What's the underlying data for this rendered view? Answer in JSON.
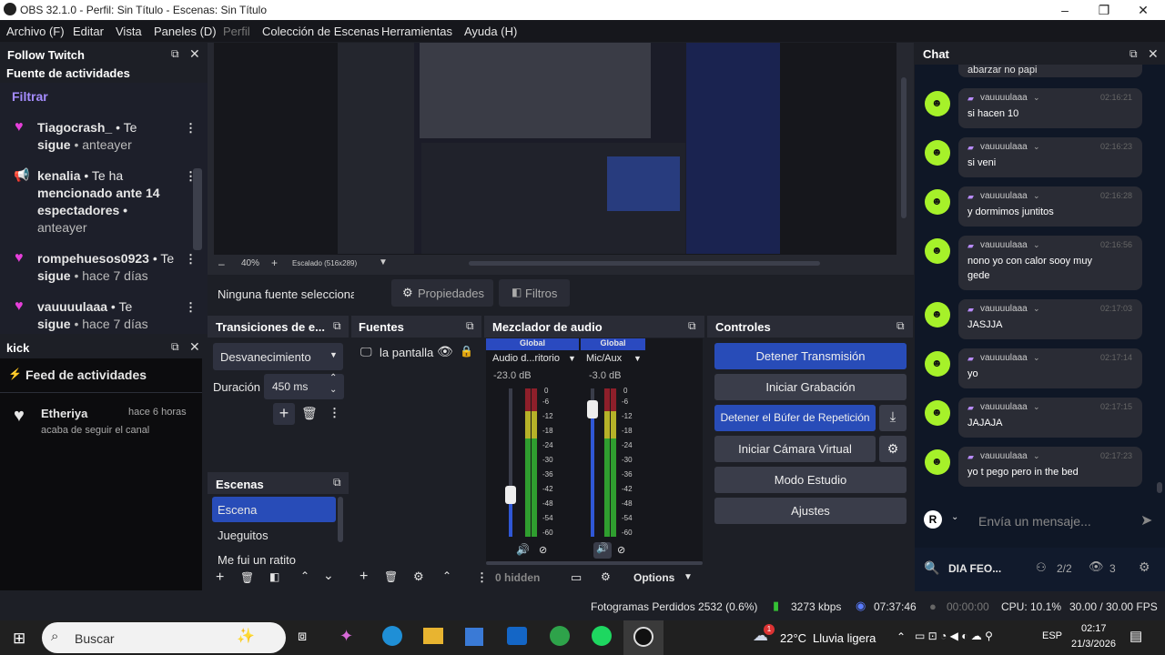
{
  "titlebar": {
    "title": "OBS 32.1.0 - Perfil: Sin Título - Escenas: Sin Título"
  },
  "menu": [
    "Archivo (F)",
    "Editar",
    "Vista",
    "Paneles (D)",
    "Perfil",
    "Colección de Escenas",
    "Herramientas",
    "Ayuda (H)"
  ],
  "follow": {
    "title": "Follow Twitch",
    "subtitle": "Fuente de actividades",
    "filter": "Filtrar",
    "items": [
      {
        "name": "Tiagocrash_",
        "line1": " • Te",
        "line2a": "sigue",
        "line2b": " • anteayer"
      },
      {
        "name": "kenalia",
        "line1": " • Te ha",
        "line2": "mencionado ante 14",
        "line3": "espectadores •",
        "line4": "anteayer"
      },
      {
        "name": "rompehuesos0923",
        "line1": " • Te",
        "line2a": "sigue",
        "line2b": " • hace 7 días"
      },
      {
        "name": "vauuuulaaa",
        "line1": " • Te",
        "line2a": "sigue",
        "line2b": " • hace 7 días"
      }
    ]
  },
  "kick": {
    "title": "kick",
    "feed": "Feed de actividades",
    "item": {
      "name": "Etheriya",
      "time": "hace 6 horas",
      "desc": "acaba de seguir el canal"
    }
  },
  "preview": {
    "zoom": "40%",
    "scale": "Escalado (516x289)"
  },
  "sourcebar": {
    "none": "Ninguna fuente seleccionad",
    "properties": "Propiedades",
    "filters": "Filtros"
  },
  "transitions": {
    "title": "Transiciones de e...",
    "value": "Desvanecimiento",
    "duration_label": "Duración",
    "duration": "450 ms"
  },
  "scenes": {
    "title": "Escenas",
    "items": [
      "Escena",
      "Jueguitos",
      "Me fui un ratito"
    ]
  },
  "sources": {
    "title": "Fuentes",
    "item": "la pantalla"
  },
  "mixer": {
    "title": "Mezclador de audio",
    "ch1": {
      "tag": "Global",
      "name": "Audio d...ritorio",
      "db": "-23.0 dB",
      "level": 0.28
    },
    "ch2": {
      "tag": "Global",
      "name": "Mic/Aux",
      "db": "-3.0 dB",
      "level": 0.86
    },
    "ticks": [
      "0",
      "-6",
      "-12",
      "-18",
      "-24",
      "-30",
      "-36",
      "-42",
      "-48",
      "-54",
      "-60"
    ],
    "hidden": "0 hidden",
    "options": "Options"
  },
  "controls": {
    "title": "Controles",
    "stream": "Detener Transmisión",
    "record": "Iniciar Grabación",
    "replay": "Detener el Búfer de Repetición",
    "vcam": "Iniciar Cámara Virtual",
    "studio": "Modo Estudio",
    "settings": "Ajustes"
  },
  "status": {
    "dropped": "Fotogramas Perdidos 2532 (0.6%)",
    "kbps": "3273 kbps",
    "live": "07:37:46",
    "rec": "00:00:00",
    "cpu": "CPU: 10.1%",
    "fps": "30.00 / 30.00 FPS"
  },
  "chat": {
    "title": "Chat",
    "first": "abarzar no papi",
    "msgs": [
      {
        "user": "vauuuulaaa",
        "time": "02:16:21",
        "text": "si hacen 10"
      },
      {
        "user": "vauuuulaaa",
        "time": "02:16:23",
        "text": "si veni"
      },
      {
        "user": "vauuuulaaa",
        "time": "02:16:28",
        "text": "y dormimos juntitos"
      },
      {
        "user": "vauuuulaaa",
        "time": "02:16:56",
        "text": "nono yo con calor sooy muy",
        "text2": "gede"
      },
      {
        "user": "vauuuulaaa",
        "time": "02:17:03",
        "text": "JASJJA"
      },
      {
        "user": "vauuuulaaa",
        "time": "02:17:14",
        "text": "yo"
      },
      {
        "user": "vauuuulaaa",
        "time": "02:17:15",
        "text": "JAJAJA"
      },
      {
        "user": "vauuuulaaa",
        "time": "02:17:23",
        "text": "yo t pego pero in the bed"
      }
    ],
    "placeholder": "Envía un mensaje...",
    "stream": "DIA FEO...",
    "count1": "2/2",
    "count2": "3"
  },
  "taskbar": {
    "search": "Buscar",
    "weather": "22°C",
    "weather2": "Lluvia ligera",
    "lang": "ESP",
    "time": "02:17",
    "date": "21/3/2026",
    "badge": "1"
  },
  "colors": {
    "accent": "#284cb8",
    "chat_avatar": "#a6f12a",
    "heart": "#e53fd9",
    "meter_green": "#2f9e2f",
    "meter_yellow": "#b6b228",
    "meter_red": "#8e1f2a"
  }
}
